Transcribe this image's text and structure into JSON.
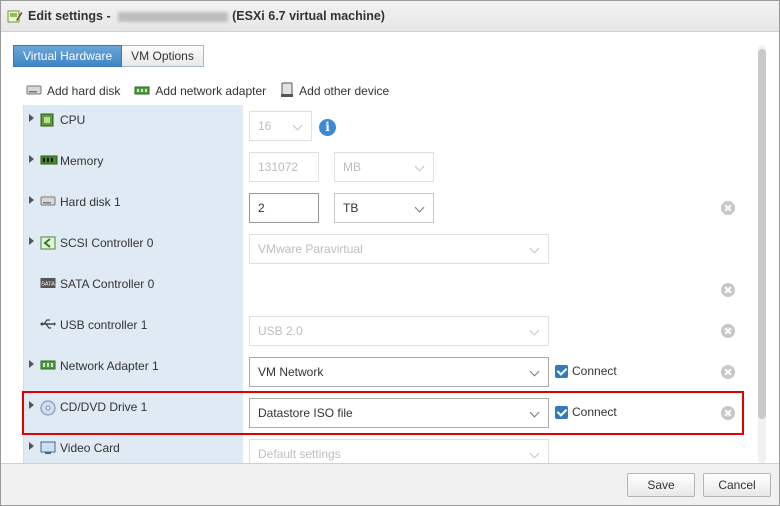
{
  "window": {
    "title_prefix": "Edit settings - ",
    "title_suffix": "(ESXi 6.7 virtual machine)"
  },
  "tabs": [
    {
      "label": "Virtual Hardware",
      "active": true
    },
    {
      "label": "VM Options",
      "active": false
    }
  ],
  "toolbar": {
    "add_hard_disk": "Add hard disk",
    "add_network_adapter": "Add network adapter",
    "add_other_device": "Add other device"
  },
  "hardware": {
    "cpu": {
      "label": "CPU",
      "value": "16"
    },
    "memory": {
      "label": "Memory",
      "value": "131072",
      "unit": "MB"
    },
    "hard_disk": {
      "label": "Hard disk 1",
      "value": "2",
      "unit": "TB"
    },
    "scsi": {
      "label": "SCSI Controller 0",
      "value": "VMware Paravirtual"
    },
    "sata": {
      "label": "SATA Controller 0"
    },
    "usb": {
      "label": "USB controller 1",
      "value": "USB 2.0"
    },
    "network": {
      "label": "Network Adapter 1",
      "value": "VM Network",
      "connect_label": "Connect"
    },
    "cdrom": {
      "label": "CD/DVD Drive 1",
      "value": "Datastore ISO file",
      "connect_label": "Connect"
    },
    "video": {
      "label": "Video Card",
      "value": "Default settings"
    }
  },
  "footer": {
    "save_label": "Save",
    "cancel_label": "Cancel"
  },
  "colors": {
    "accent": "#3f86c6",
    "label_bg": "#dfeaf4",
    "highlight": "#e10000"
  }
}
